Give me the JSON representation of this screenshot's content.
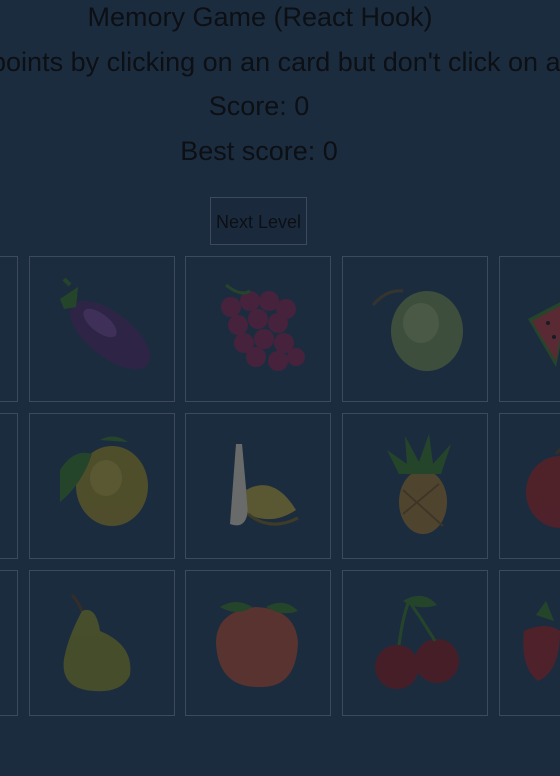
{
  "header": {
    "title": "Memory Game (React Hook)",
    "instructions": "Get points by clicking on an card but don't click on any more than once!",
    "score_label": "Score: 0",
    "best_score_label": "Best score: 0"
  },
  "controls": {
    "next_level_label": "Next Level"
  },
  "cards": [
    {
      "fruit": "partial-left"
    },
    {
      "fruit": "eggplant"
    },
    {
      "fruit": "grapes"
    },
    {
      "fruit": "melon"
    },
    {
      "fruit": "watermelon"
    },
    {
      "fruit": "partial-left"
    },
    {
      "fruit": "lemon"
    },
    {
      "fruit": "banana"
    },
    {
      "fruit": "pineapple"
    },
    {
      "fruit": "red-apple"
    },
    {
      "fruit": "partial-left"
    },
    {
      "fruit": "pear"
    },
    {
      "fruit": "peach"
    },
    {
      "fruit": "cherries"
    },
    {
      "fruit": "strawberry"
    }
  ],
  "colors": {
    "overlay_background": "#1c2c3f",
    "card_border": "#3c4a5c",
    "text": "#0c0f14"
  }
}
